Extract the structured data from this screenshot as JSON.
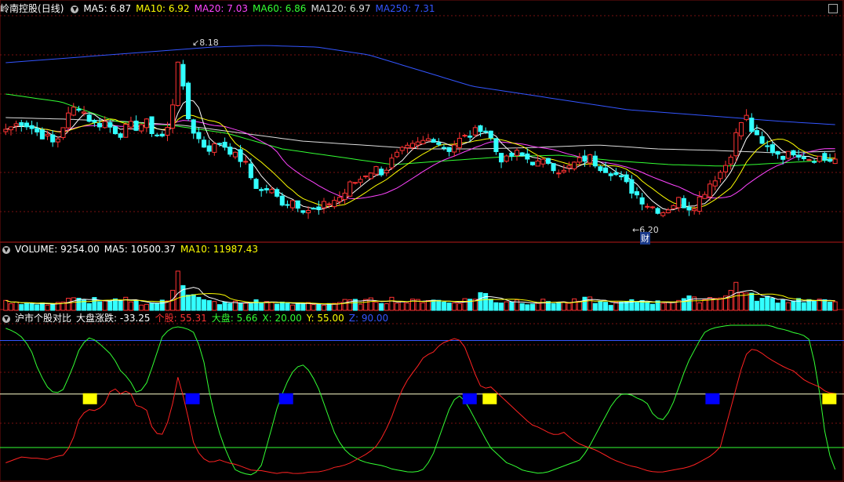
{
  "stock": {
    "name": "岭南控股",
    "period": "(日线)"
  },
  "price_panel": {
    "indicators": [
      {
        "label": "MA5: 6.87",
        "color": "#ffffff"
      },
      {
        "label": "MA10: 6.92",
        "color": "#ffff00"
      },
      {
        "label": "MA20: 7.03",
        "color": "#ff44ff"
      },
      {
        "label": "MA60: 6.86",
        "color": "#33ff33"
      },
      {
        "label": "MA120: 6.97",
        "color": "#dddddd"
      },
      {
        "label": "MA250: 7.31",
        "color": "#3355ff"
      }
    ],
    "high_marker": "8.18",
    "low_marker": "6.20",
    "finance_badge": "财"
  },
  "volume_panel": {
    "indicators": [
      {
        "label": "VOLUME: 9254.00",
        "color": "#ffffff"
      },
      {
        "label": "MA5: 10500.37",
        "color": "#ffffff"
      },
      {
        "label": "MA10: 11987.43",
        "color": "#ffff00"
      }
    ]
  },
  "indicator_panel": {
    "title": "沪市个股对比",
    "indicators": [
      {
        "label": "大盘涨跌: -33.25",
        "color": "#ffffff"
      },
      {
        "label": "个股: 55.31",
        "color": "#ff3333"
      },
      {
        "label": "大盘: 5.66",
        "color": "#33ff33"
      },
      {
        "label": "X: 20.00",
        "color": "#33ff33"
      },
      {
        "label": "Y: 55.00",
        "color": "#ffff00"
      },
      {
        "label": "Z: 90.00",
        "color": "#3355ff"
      }
    ],
    "levels": {
      "x": 20,
      "y": 55,
      "z": 90
    }
  },
  "colors": {
    "up": "#ff3333",
    "down": "#33ffff",
    "grid": "#7a1010",
    "ma5": "#ffffff",
    "ma10": "#ffff00",
    "ma20": "#ff44ff",
    "ma60": "#33ff33",
    "ma120": "#dddddd",
    "ma250": "#3355ff",
    "stock_line": "#ff2222",
    "market_line": "#33ff33"
  },
  "chart_data": {
    "type": "candlestick",
    "price_range": [
      5.9,
      8.7
    ],
    "close_path": [
      7.25,
      7.3,
      7.35,
      7.28,
      7.2,
      7.15,
      7.05,
      7.3,
      7.5,
      7.55,
      7.4,
      7.3,
      7.35,
      7.25,
      7.2,
      7.3,
      7.28,
      7.35,
      7.2,
      7.15,
      7.3,
      8.18,
      7.45,
      7.2,
      7.05,
      7.0,
      7.08,
      7.02,
      6.9,
      6.85,
      6.6,
      6.45,
      6.5,
      6.38,
      6.3,
      6.35,
      6.25,
      6.22,
      6.2,
      6.3,
      6.35,
      6.4,
      6.55,
      6.6,
      6.7,
      6.75,
      6.7,
      6.85,
      6.95,
      7.0,
      7.05,
      7.1,
      7.15,
      7.05,
      7.0,
      7.1,
      7.15,
      7.2,
      7.3,
      7.15,
      6.9,
      6.85,
      6.95,
      6.9,
      6.85,
      6.8,
      6.85,
      6.75,
      6.7,
      6.8,
      6.85,
      6.9,
      6.8,
      6.75,
      6.7,
      6.6,
      6.5,
      6.4,
      6.3,
      6.25,
      6.2,
      6.28,
      6.35,
      6.25,
      6.3,
      6.45,
      6.6,
      6.7,
      6.85,
      7.2,
      7.45,
      7.2,
      7.05,
      7.0,
      6.95,
      6.9,
      6.98,
      6.92,
      6.88,
      6.9,
      6.85,
      6.87
    ],
    "volume_range": [
      0,
      60000
    ],
    "volume_path": [
      9000,
      10000,
      8000,
      7500,
      6000,
      7000,
      8000,
      9500,
      12000,
      11000,
      9000,
      13000,
      8000,
      9500,
      10000,
      12000,
      9000,
      7000,
      8000,
      9000,
      10000,
      55000,
      20000,
      15000,
      10000,
      9000,
      8000,
      7000,
      8500,
      7000,
      9000,
      10000,
      8000,
      9000,
      7000,
      6000,
      7000,
      8000,
      6500,
      7000,
      8000,
      9000,
      10000,
      9000,
      10000,
      11000,
      9000,
      12000,
      10000,
      9000,
      10000,
      11000,
      13000,
      9000,
      8000,
      10000,
      11000,
      13000,
      20000,
      12000,
      9000,
      10000,
      11000,
      9000,
      8000,
      9000,
      10000,
      8500,
      8000,
      9500,
      10000,
      12000,
      9000,
      8000,
      7000,
      8000,
      9000,
      10000,
      11000,
      8000,
      9000,
      10000,
      12000,
      13000,
      11000,
      12000,
      14000,
      17000,
      15000,
      31000,
      18000,
      14000,
      12000,
      13000,
      11000,
      10000,
      12000,
      11000,
      10000,
      9500,
      9300,
      9254
    ],
    "indicator_range": [
      0,
      100
    ],
    "stock_series_path": [
      10,
      12,
      14,
      13,
      13,
      12,
      14,
      15,
      22,
      40,
      45,
      44,
      48,
      60,
      55,
      58,
      46,
      47,
      30,
      28,
      40,
      67,
      45,
      20,
      13,
      10,
      12,
      10,
      9,
      7,
      5,
      5,
      4,
      3,
      4,
      3,
      3,
      4,
      4,
      5,
      7,
      8,
      10,
      13,
      16,
      20,
      28,
      40,
      55,
      65,
      72,
      80,
      82,
      88,
      90,
      92,
      85,
      70,
      58,
      60,
      55,
      50,
      45,
      40,
      35,
      33,
      30,
      28,
      30,
      25,
      22,
      20,
      18,
      15,
      12,
      10,
      8,
      7,
      5,
      4,
      4,
      5,
      6,
      7,
      9,
      12,
      15,
      20,
      40,
      60,
      80,
      85,
      82,
      78,
      75,
      72,
      70,
      65,
      62,
      60,
      56,
      55.31
    ],
    "market_series_path": [
      98,
      96,
      92,
      85,
      70,
      60,
      55,
      58,
      70,
      85,
      92,
      90,
      85,
      80,
      70,
      65,
      55,
      60,
      75,
      92,
      98,
      99,
      98,
      95,
      80,
      50,
      30,
      15,
      5,
      3,
      2,
      6,
      25,
      45,
      60,
      70,
      75,
      70,
      60,
      45,
      30,
      20,
      15,
      12,
      10,
      9,
      8,
      6,
      5,
      4,
      4,
      6,
      15,
      30,
      45,
      55,
      50,
      40,
      30,
      20,
      15,
      10,
      8,
      5,
      4,
      3,
      4,
      6,
      8,
      10,
      12,
      20,
      30,
      40,
      50,
      55,
      55,
      52,
      50,
      40,
      38,
      45,
      60,
      75,
      85,
      95,
      98,
      99,
      100,
      100,
      100,
      100,
      100,
      100,
      98,
      97,
      95,
      94,
      90,
      60,
      20,
      5.66
    ],
    "signal_blocks": [
      {
        "at": 0.104,
        "color": "#ffff00"
      },
      {
        "at": 0.227,
        "color": "#0000ff"
      },
      {
        "at": 0.339,
        "color": "#0000ff"
      },
      {
        "at": 0.559,
        "color": "#0000ff"
      },
      {
        "at": 0.583,
        "color": "#ffff00"
      },
      {
        "at": 0.85,
        "color": "#0000ff"
      },
      {
        "at": 0.99,
        "color": "#ffff00"
      }
    ]
  }
}
